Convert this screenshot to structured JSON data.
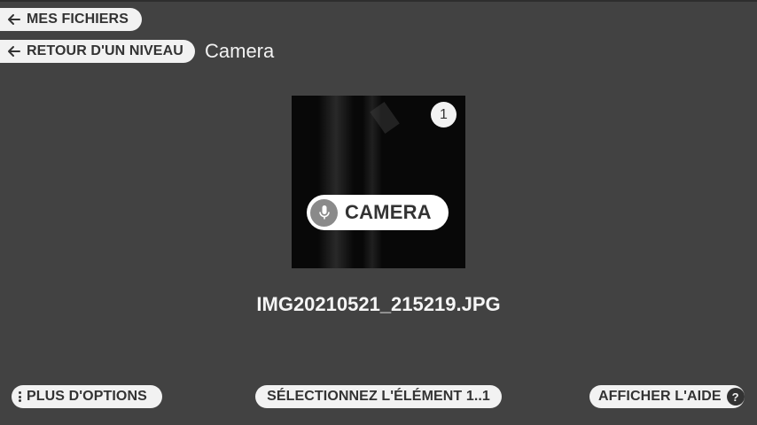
{
  "nav": {
    "my_files_label": "MES FICHIERS",
    "back_label": "RETOUR D'UN NIVEAU",
    "folder_name": "Camera"
  },
  "preview": {
    "count_badge": "1",
    "voice_label": "CAMERA",
    "file_name": "IMG20210521_215219.JPG"
  },
  "footer": {
    "options_label": "PLUS D'OPTIONS",
    "select_label": "SÉLECTIONNEZ L'ÉLÉMENT 1..1",
    "help_label": "AFFICHER L'AIDE",
    "help_icon_text": "?"
  },
  "icons": {
    "back": "arrow-left-icon",
    "mic": "microphone-icon",
    "more": "more-vertical-icon",
    "help": "help-icon"
  },
  "colors": {
    "background": "#424242",
    "pill": "#f2f2f2",
    "pill_text": "#333333"
  }
}
